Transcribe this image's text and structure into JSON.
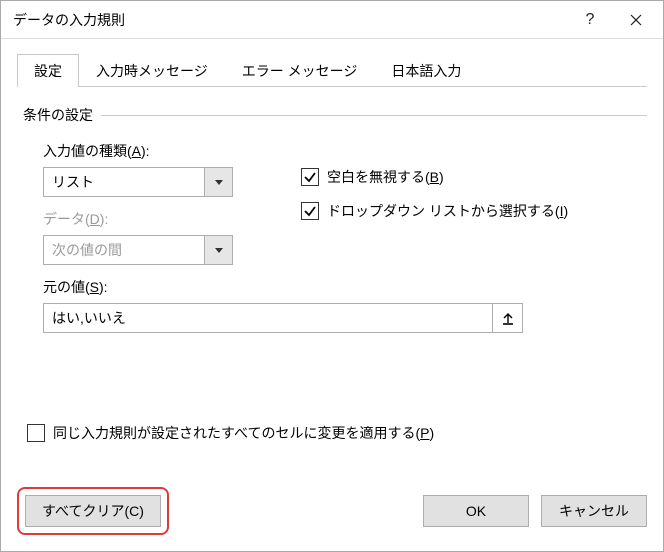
{
  "title": "データの入力規則",
  "tabs": {
    "settings": "設定",
    "input_message": "入力時メッセージ",
    "error_message": "エラー メッセージ",
    "ime": "日本語入力"
  },
  "fieldset": "条件の設定",
  "allow_label_prefix": "入力値の種類(",
  "allow_label_key": "A",
  "allow_label_suffix": "):",
  "allow_value": "リスト",
  "data_label_prefix": "データ(",
  "data_label_key": "D",
  "data_label_suffix": "):",
  "data_value": "次の値の間",
  "ignore_blank_prefix": "空白を無視する(",
  "ignore_blank_key": "B",
  "ignore_blank_suffix": ")",
  "dropdown_prefix": "ドロップダウン リストから選択する(",
  "dropdown_key": "I",
  "dropdown_suffix": ")",
  "source_label_prefix": "元の値(",
  "source_label_key": "S",
  "source_label_suffix": "):",
  "source_value": "はい,いいえ",
  "apply_prefix": "同じ入力規則が設定されたすべてのセルに変更を適用する(",
  "apply_key": "P",
  "apply_suffix": ")",
  "clear_prefix": "すべてクリア(",
  "clear_key": "C",
  "clear_suffix": ")",
  "ok": "OK",
  "cancel": "キャンセル"
}
